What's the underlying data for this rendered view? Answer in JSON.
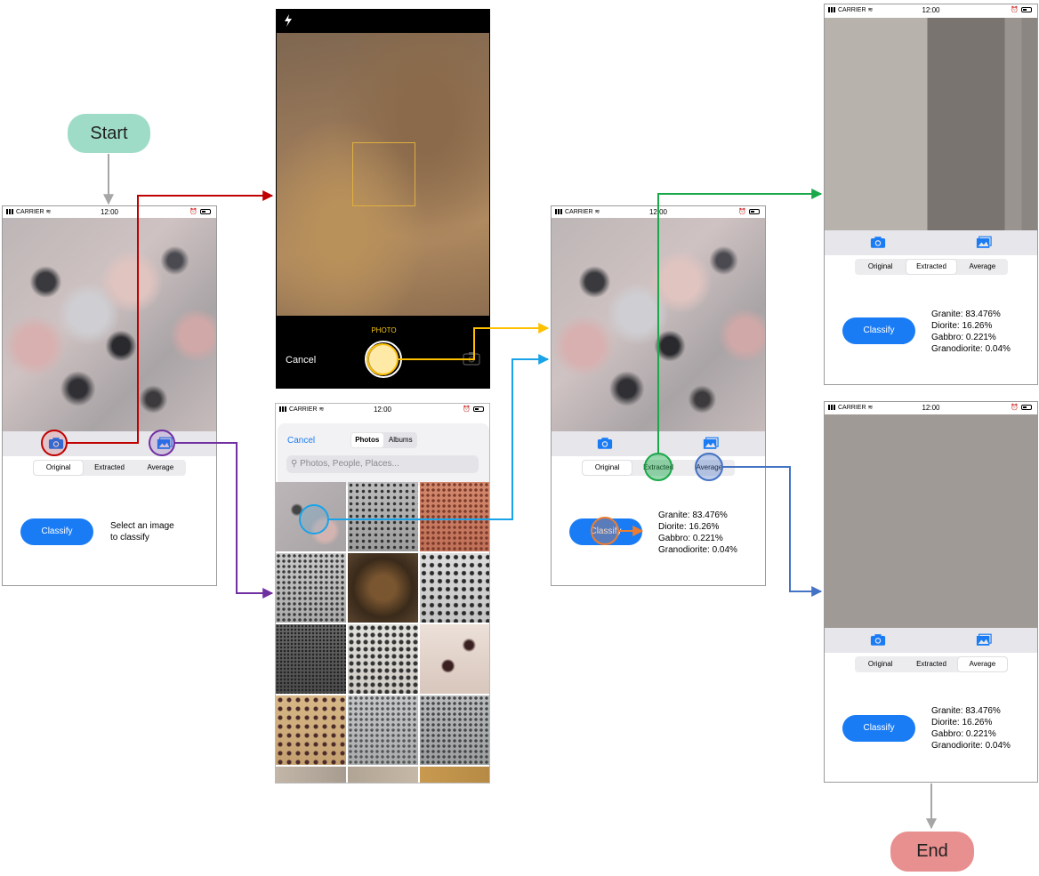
{
  "nodes": {
    "start": "Start",
    "end": "End"
  },
  "status": {
    "carrier": "CARRIER",
    "time": "12:00"
  },
  "screen1": {
    "segments": [
      "Original",
      "Extracted",
      "Average"
    ],
    "selected": 0,
    "classify": "Classify",
    "hint": "Select an image\nto classify"
  },
  "camera": {
    "mode": "PHOTO",
    "cancel": "Cancel"
  },
  "picker": {
    "cancel": "Cancel",
    "tabs": [
      "Photos",
      "Albums"
    ],
    "search_placeholder": "Photos, People, Places..."
  },
  "screen3": {
    "segments": [
      "Original",
      "Extracted",
      "Average"
    ],
    "selected": 0,
    "classify": "Classify",
    "results": "Granite: 83.476%\nDiorite: 16.26%\nGabbro: 0.221%\nGranodiorite: 0.04%"
  },
  "screen4": {
    "segments": [
      "Original",
      "Extracted",
      "Average"
    ],
    "selected": 1,
    "classify": "Classify",
    "results": "Granite: 83.476%\nDiorite: 16.26%\nGabbro: 0.221%\nGranodiorite: 0.04%"
  },
  "screen5": {
    "segments": [
      "Original",
      "Extracted",
      "Average"
    ],
    "selected": 2,
    "classify": "Classify",
    "results": "Granite: 83.476%\nDiorite: 16.26%\nGabbro: 0.221%\nGranodiorite: 0.04%"
  },
  "colors": {
    "start_node": "#9fdcc8",
    "end_node": "#e88f8f",
    "arrow_camera": "#c00000",
    "arrow_gallery": "#7030a0",
    "arrow_shutter": "#ffc000",
    "arrow_photo": "#1aa3e8",
    "arrow_classify": "#ed7d31",
    "arrow_extracted": "#1aa84a",
    "arrow_average": "#4472c4",
    "flow_gray": "#a6a6a6",
    "ios_blue": "#1a7cf5"
  }
}
